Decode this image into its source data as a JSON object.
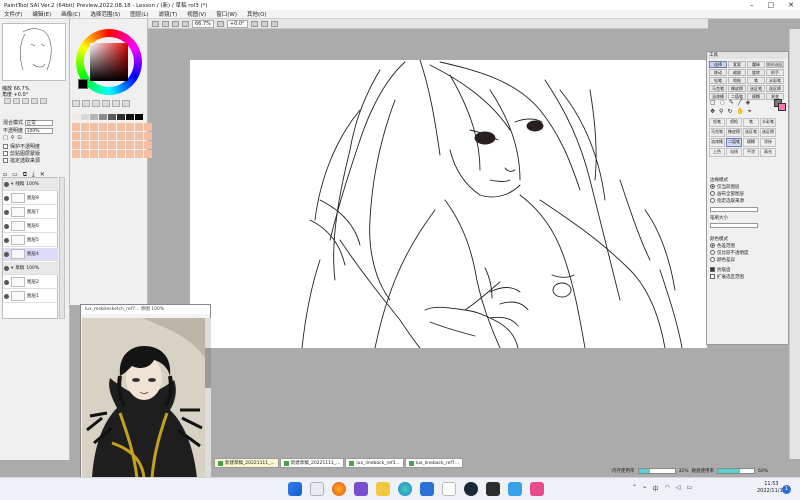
{
  "titlebar": {
    "title": "PaintTool SAI Ver.2 (64bit) Preview.2022.08.18 - Lesson / (新) / 草稿 rol3 (*)"
  },
  "menu": [
    "文件(F)",
    "编辑(E)",
    "画像(C)",
    "选择范围(S)",
    "图层(L)",
    "滤镜(T)",
    "视图(V)",
    "窗口(W)",
    "其他(O)"
  ],
  "left": {
    "zoom_label": "缩放 66.7%",
    "angle_label": "角度 +0.0°",
    "blend_label": "混合模式",
    "blend_value": "正常",
    "opacity_label": "不透明度",
    "opacity_value": "100%",
    "protect_label": "保护不透明度",
    "clip_label": "剪贴图层蒙版",
    "ref_label": "指定选取来源",
    "layers": [
      {
        "name": "线稿",
        "pct": "100%",
        "type": "folder"
      },
      {
        "name": "图层8",
        "pct": "100%",
        "type": "layer"
      },
      {
        "name": "图层7",
        "pct": "100%",
        "type": "layer"
      },
      {
        "name": "图层6",
        "pct": "100%",
        "type": "layer"
      },
      {
        "name": "图层5",
        "pct": "100%",
        "type": "layer"
      },
      {
        "name": "图层4",
        "pct": "100%",
        "type": "selected"
      },
      {
        "name": "草稿",
        "pct": "100%",
        "type": "folder"
      },
      {
        "name": "图层2",
        "pct": "100%",
        "type": "layer"
      },
      {
        "name": "图层1",
        "pct": "100%",
        "type": "layer"
      }
    ]
  },
  "canvas_toolbar": {
    "zoom": "66.7%",
    "angle": "+0.0°"
  },
  "tool_panel": {
    "header": "工具",
    "tools": [
      "选择",
      "套索",
      "魔棒",
      "矩形选区",
      "移动",
      "缩放",
      "旋转",
      "抓手",
      "铅笔",
      "喷枪",
      "笔",
      "水彩笔",
      "马克笔",
      "橡皮擦",
      "选区笔",
      "选区擦",
      "油漆桶",
      "二值笔",
      "模糊",
      "渐变"
    ],
    "brushes": [
      "铅笔",
      "喷枪",
      "笔",
      "水彩笔",
      "马克笔",
      "橡皮擦",
      "选区笔",
      "选区擦",
      "油漆桶",
      "二值笔",
      "模糊",
      "涂抹",
      "上色",
      "勾线",
      "平涂",
      "高光"
    ],
    "mode_label": "边缘模式",
    "opt1": "仅当前图层",
    "opt2": "画布全部图层",
    "opt3": "指定选取来源",
    "size_label": "笔刷大小",
    "color_label": "颜色模式",
    "opt4": "色差范围",
    "opt5": "仅比较不透明度",
    "opt6": "颜色差异",
    "chk1": "抗锯齿",
    "chk2": "扩展选区范围"
  },
  "ref_window": {
    "title": "lux_mobilesketch_ref7... 原图 100%"
  },
  "doc_tabs": [
    {
      "label": "新建草稿_20221111_...",
      "active": true
    },
    {
      "label": "新建草稿_20221111_...",
      "active": false
    },
    {
      "label": "lux_lineback_ref3...",
      "active": false
    },
    {
      "label": "lux_lineback_ref7...",
      "active": false
    }
  ],
  "status": {
    "memory_label": "内存使用率",
    "memory_value": "32%",
    "disk_label": "磁盘使用率",
    "disk_value": "60%",
    "memory_fraction": 0.32,
    "disk_fraction": 0.6
  },
  "taskbar": {
    "time": "11:53",
    "date": "2022/11/11",
    "notification_count": "1",
    "icons": [
      "windows-start",
      "search",
      "firefox",
      "visual-studio",
      "file-explorer",
      "edge",
      "store",
      "sai",
      "steam",
      "terminal",
      "paint",
      "photo"
    ]
  },
  "colors": {
    "accent": "#6d7fb8",
    "peach": "#f3c0a3",
    "selected_layer": "#dcdcf8",
    "pink_swatch": "#ff72b8"
  }
}
